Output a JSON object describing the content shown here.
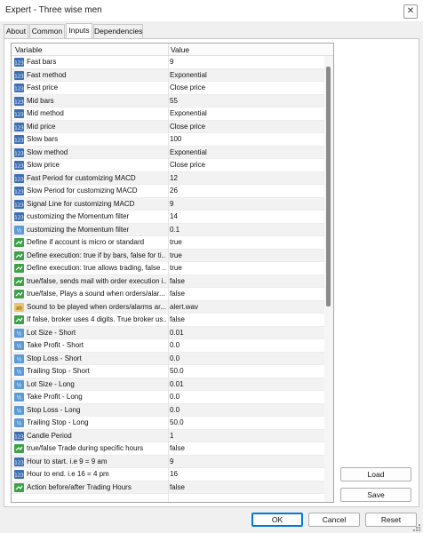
{
  "window": {
    "title": "Expert - Three wise men",
    "close_glyph": "✕"
  },
  "tabs": [
    {
      "label": "About",
      "active": false
    },
    {
      "label": "Common",
      "active": false
    },
    {
      "label": "Inputs",
      "active": true
    },
    {
      "label": "Dependencies",
      "active": false
    }
  ],
  "table": {
    "columns": [
      "Variable",
      "Value"
    ],
    "rows": [
      {
        "type": "int",
        "variable": "Fast bars",
        "value": "9"
      },
      {
        "type": "enum",
        "variable": "Fast method",
        "value": "Exponential"
      },
      {
        "type": "enum",
        "variable": "Fast price",
        "value": "Close price"
      },
      {
        "type": "int",
        "variable": "Mid bars",
        "value": "55"
      },
      {
        "type": "enum",
        "variable": "Mid method",
        "value": "Exponential"
      },
      {
        "type": "enum",
        "variable": "Mid price",
        "value": "Close price"
      },
      {
        "type": "int",
        "variable": "Slow bars",
        "value": "100"
      },
      {
        "type": "enum",
        "variable": "Slow method",
        "value": "Exponential"
      },
      {
        "type": "enum",
        "variable": "Slow price",
        "value": "Close price"
      },
      {
        "type": "int",
        "variable": "Fast Period for customizing MACD",
        "value": "12"
      },
      {
        "type": "int",
        "variable": "Slow Period for customizing MACD",
        "value": "26"
      },
      {
        "type": "int",
        "variable": "Signal Line for customizing MACD",
        "value": "9"
      },
      {
        "type": "int",
        "variable": "customizing the Momentum filter",
        "value": "14"
      },
      {
        "type": "dbl",
        "variable": "customizing the Momentum filter",
        "value": "0.1"
      },
      {
        "type": "bool",
        "variable": "Define if account is micro or standard",
        "value": "true"
      },
      {
        "type": "bool",
        "variable": "Define execution: true if by bars, false for ti...",
        "value": "true"
      },
      {
        "type": "bool",
        "variable": "Define execution: true allows trading, false ...",
        "value": "true"
      },
      {
        "type": "bool",
        "variable": "true/false, sends mail with order execution i...",
        "value": "false"
      },
      {
        "type": "bool",
        "variable": "true/false, Plays a sound when orders/alar...",
        "value": "false"
      },
      {
        "type": "str",
        "variable": "Sound to be played when orders/alarms ar...",
        "value": "alert.wav"
      },
      {
        "type": "bool",
        "variable": "If false, broker uses 4 digits. True broker us...",
        "value": "false"
      },
      {
        "type": "dbl",
        "variable": "Lot Size - Short",
        "value": "0.01"
      },
      {
        "type": "dbl",
        "variable": "Take Profit - Short",
        "value": "0.0"
      },
      {
        "type": "dbl",
        "variable": "Stop Loss - Short",
        "value": "0.0"
      },
      {
        "type": "dbl",
        "variable": "Trailing Stop - Short",
        "value": "50.0"
      },
      {
        "type": "dbl",
        "variable": "Lot Size - Long",
        "value": "0.01"
      },
      {
        "type": "dbl",
        "variable": "Take Profit - Long",
        "value": "0.0"
      },
      {
        "type": "dbl",
        "variable": "Stop Loss - Long",
        "value": "0.0"
      },
      {
        "type": "dbl",
        "variable": "Trailing Stop - Long",
        "value": "50.0"
      },
      {
        "type": "int",
        "variable": "Candle Period",
        "value": "1"
      },
      {
        "type": "bool",
        "variable": "true/false Trade during specific hours",
        "value": "false"
      },
      {
        "type": "int",
        "variable": "Hour to start. i.e 9 = 9 am",
        "value": "9"
      },
      {
        "type": "int",
        "variable": "Hour to end. i.e 16 = 4 pm",
        "value": "16"
      },
      {
        "type": "bool",
        "variable": "Action before/after Trading Hours",
        "value": "false"
      }
    ]
  },
  "side_buttons": {
    "load": "Load",
    "save": "Save"
  },
  "footer_buttons": {
    "ok": "OK",
    "cancel": "Cancel",
    "reset": "Reset"
  },
  "colors": {
    "int_icon": "#3c6fb4",
    "bool_icon": "#3ca247",
    "double_icon": "#5b9bd5",
    "string_icon": "#e8c56a",
    "ok_border": "#0078d7"
  }
}
